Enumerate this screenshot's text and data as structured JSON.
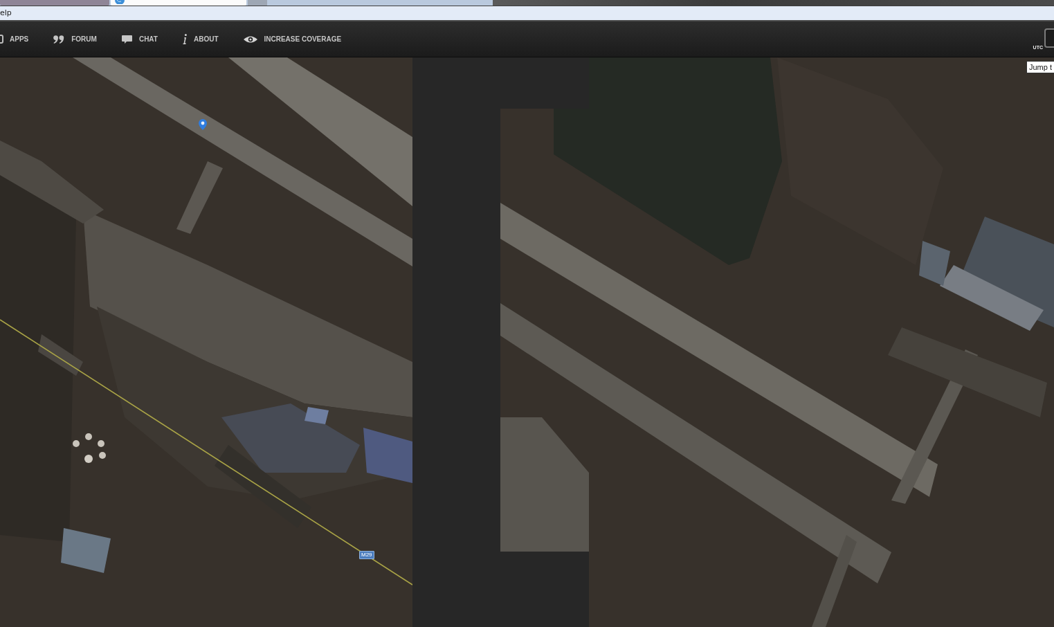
{
  "browser": {
    "tabs": [
      {
        "selected": false,
        "icon": false
      },
      {
        "selected": true,
        "icon": true
      }
    ],
    "menu": [
      "elp"
    ]
  },
  "nav": {
    "items": [
      {
        "kind": "apps",
        "label": "APPS"
      },
      {
        "kind": "forum",
        "label": "FORUM"
      },
      {
        "kind": "chat",
        "label": "CHAT"
      },
      {
        "kind": "about",
        "label": "ABOUT"
      },
      {
        "kind": "coverage",
        "label": "INCREASE COVERAGE"
      }
    ],
    "clock": {
      "zone": "UTC"
    }
  },
  "map": {
    "tooltip": "Jump t",
    "road_label": "M29"
  }
}
